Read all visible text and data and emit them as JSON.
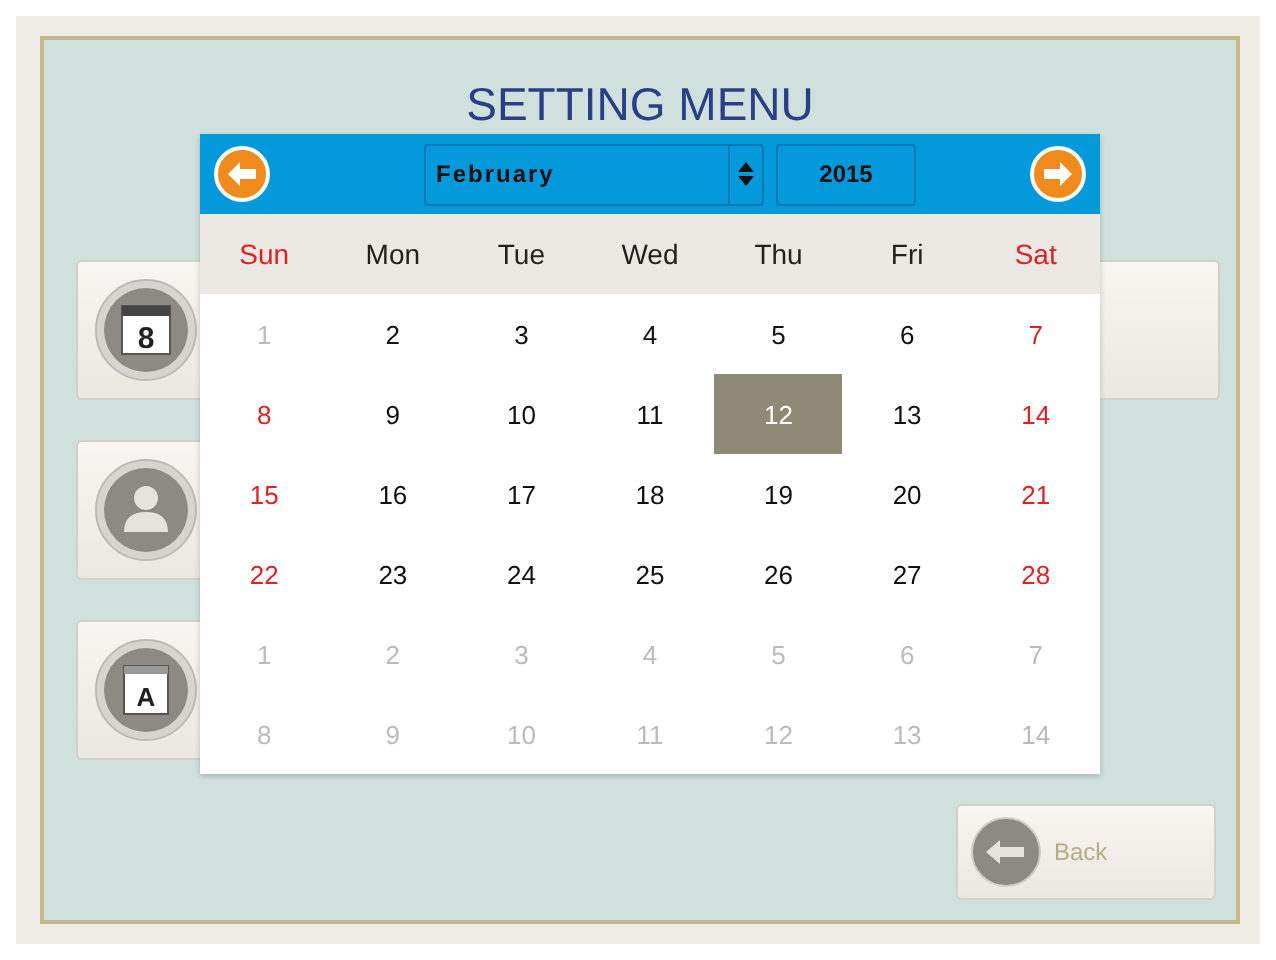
{
  "title": "SETTING MENU",
  "menu_buttons": [
    {
      "kind": "calendar",
      "icon_text": "8",
      "wide": true
    },
    {
      "kind": "person",
      "wide": false
    },
    {
      "kind": "keyboard",
      "icon_text": "A",
      "wide": false
    }
  ],
  "calendar": {
    "month": "February",
    "year": "2015",
    "weekdays": [
      {
        "label": "Sun",
        "weekend": true
      },
      {
        "label": "Mon",
        "weekend": false
      },
      {
        "label": "Tue",
        "weekend": false
      },
      {
        "label": "Wed",
        "weekend": false
      },
      {
        "label": "Thu",
        "weekend": false
      },
      {
        "label": "Fri",
        "weekend": false
      },
      {
        "label": "Sat",
        "weekend": true
      }
    ],
    "days": [
      {
        "day": "1",
        "in_month": false,
        "selected": false
      },
      {
        "day": "2",
        "in_month": true,
        "weekend": false,
        "selected": false
      },
      {
        "day": "3",
        "in_month": true,
        "weekend": false,
        "selected": false
      },
      {
        "day": "4",
        "in_month": true,
        "weekend": false,
        "selected": false
      },
      {
        "day": "5",
        "in_month": true,
        "weekend": false,
        "selected": false
      },
      {
        "day": "6",
        "in_month": true,
        "weekend": false,
        "selected": false
      },
      {
        "day": "7",
        "in_month": true,
        "weekend": true,
        "selected": false
      },
      {
        "day": "8",
        "in_month": true,
        "weekend": true,
        "selected": false
      },
      {
        "day": "9",
        "in_month": true,
        "weekend": false,
        "selected": false
      },
      {
        "day": "10",
        "in_month": true,
        "weekend": false,
        "selected": false
      },
      {
        "day": "11",
        "in_month": true,
        "weekend": false,
        "selected": false
      },
      {
        "day": "12",
        "in_month": true,
        "weekend": false,
        "selected": true
      },
      {
        "day": "13",
        "in_month": true,
        "weekend": false,
        "selected": false
      },
      {
        "day": "14",
        "in_month": true,
        "weekend": true,
        "selected": false
      },
      {
        "day": "15",
        "in_month": true,
        "weekend": true,
        "selected": false
      },
      {
        "day": "16",
        "in_month": true,
        "weekend": false,
        "selected": false
      },
      {
        "day": "17",
        "in_month": true,
        "weekend": false,
        "selected": false
      },
      {
        "day": "18",
        "in_month": true,
        "weekend": false,
        "selected": false
      },
      {
        "day": "19",
        "in_month": true,
        "weekend": false,
        "selected": false
      },
      {
        "day": "20",
        "in_month": true,
        "weekend": false,
        "selected": false
      },
      {
        "day": "21",
        "in_month": true,
        "weekend": true,
        "selected": false
      },
      {
        "day": "22",
        "in_month": true,
        "weekend": true,
        "selected": false
      },
      {
        "day": "23",
        "in_month": true,
        "weekend": false,
        "selected": false
      },
      {
        "day": "24",
        "in_month": true,
        "weekend": false,
        "selected": false
      },
      {
        "day": "25",
        "in_month": true,
        "weekend": false,
        "selected": false
      },
      {
        "day": "26",
        "in_month": true,
        "weekend": false,
        "selected": false
      },
      {
        "day": "27",
        "in_month": true,
        "weekend": false,
        "selected": false
      },
      {
        "day": "28",
        "in_month": true,
        "weekend": true,
        "selected": false
      },
      {
        "day": "1",
        "in_month": false,
        "selected": false
      },
      {
        "day": "2",
        "in_month": false,
        "selected": false
      },
      {
        "day": "3",
        "in_month": false,
        "selected": false
      },
      {
        "day": "4",
        "in_month": false,
        "selected": false
      },
      {
        "day": "5",
        "in_month": false,
        "selected": false
      },
      {
        "day": "6",
        "in_month": false,
        "selected": false
      },
      {
        "day": "7",
        "in_month": false,
        "selected": false
      },
      {
        "day": "8",
        "in_month": false,
        "selected": false
      },
      {
        "day": "9",
        "in_month": false,
        "selected": false
      },
      {
        "day": "10",
        "in_month": false,
        "selected": false
      },
      {
        "day": "11",
        "in_month": false,
        "selected": false
      },
      {
        "day": "12",
        "in_month": false,
        "selected": false
      },
      {
        "day": "13",
        "in_month": false,
        "selected": false
      },
      {
        "day": "14",
        "in_month": false,
        "selected": false
      }
    ]
  },
  "back_button": {
    "label": "Back"
  }
}
